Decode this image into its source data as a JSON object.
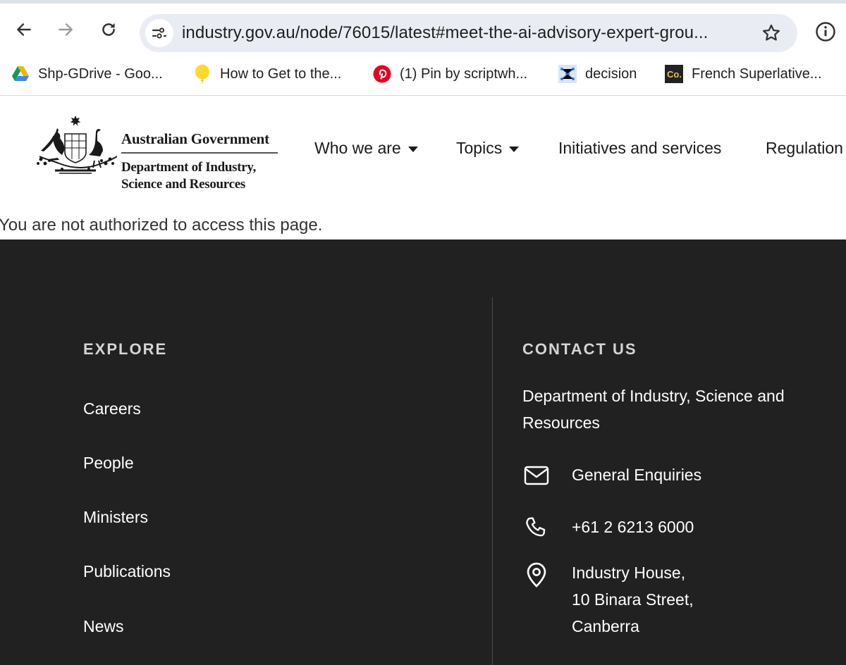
{
  "browser": {
    "url": "industry.gov.au/node/76015/latest#meet-the-ai-advisory-expert-grou...",
    "bookmarks": [
      {
        "label": "Shp-GDrive - Goo...",
        "icon": "google-drive-icon"
      },
      {
        "label": "How to Get to the...",
        "icon": "yellow-balloon-icon"
      },
      {
        "label": "(1) Pin by scriptwh...",
        "icon": "pinterest-icon"
      },
      {
        "label": "decision",
        "icon": "diagram-icon"
      },
      {
        "label": "French Superlative...",
        "icon": "co-icon"
      }
    ]
  },
  "header": {
    "logo": {
      "line1": "Australian Government",
      "line2": "Department of Industry,",
      "line3": "Science and Resources"
    },
    "nav": [
      {
        "label": "Who we are",
        "has_dropdown": true
      },
      {
        "label": "Topics",
        "has_dropdown": true
      },
      {
        "label": "Initiatives and services",
        "has_dropdown": false
      },
      {
        "label": "Regulation",
        "has_dropdown": false
      }
    ]
  },
  "main": {
    "message": "You are not authorized to access this page."
  },
  "footer": {
    "explore": {
      "heading": "EXPLORE",
      "links": [
        "Careers",
        "People",
        "Ministers",
        "Publications",
        "News"
      ]
    },
    "contact": {
      "heading": "CONTACT US",
      "department": "Department of Industry, Science and Resources",
      "email_label": "General Enquiries",
      "phone": "+61 2 6213 6000",
      "address_line1": "Industry House,",
      "address_line2": "10 Binara Street,",
      "address_line3": "Canberra"
    }
  },
  "colors": {
    "footer_bg": "#212121",
    "omnibox_bg": "#e9edf3",
    "text_dark": "#1a1a1a"
  }
}
